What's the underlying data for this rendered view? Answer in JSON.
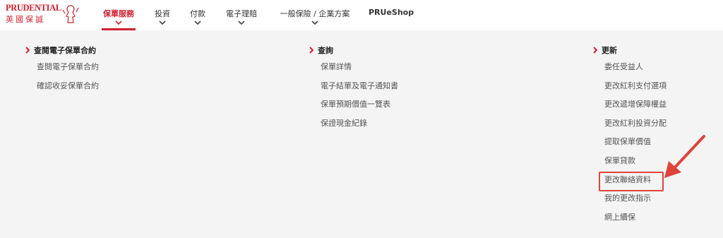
{
  "header": {
    "logo": {
      "brand": "PRUDENTIAL",
      "chinese": "英國保誠",
      "icon": "prudential-lady-logo-icon"
    },
    "nav": [
      {
        "label": "保單服務",
        "active": true,
        "chevron": true
      },
      {
        "label": "投資",
        "active": false,
        "chevron": true
      },
      {
        "label": "付款",
        "active": false,
        "chevron": true
      },
      {
        "label": "電子理賠",
        "active": false,
        "chevron": true
      },
      {
        "label": "一般保險 / 企業方案",
        "active": false,
        "chevron": true
      },
      {
        "label": "PRUeShop",
        "active": false,
        "chevron": false
      }
    ]
  },
  "menu": {
    "columns": [
      {
        "title": "查閱電子保單合約",
        "items": [
          "查閱電子保單合約",
          "確認收妥保單合約"
        ]
      },
      {
        "title": "查詢",
        "items": [
          "保單詳情",
          "電子結單及電子通知書",
          "保單預期價值一覽表",
          "保證現金紀錄"
        ]
      },
      {
        "title": "更新",
        "items": [
          "委任受益人",
          "更改紅利支付選項",
          "更改遞增保障權益",
          "更改紅利投資分配",
          "提取保單價值",
          "保單貸款",
          "更改聯絡資料",
          "我的更改指示",
          "網上續保"
        ]
      }
    ],
    "highlighted_item": "更改聯絡資料"
  },
  "colors": {
    "brand_red": "#d2202f",
    "panel_bg": "#f4f4f4",
    "annotation_red": "#e0433a"
  }
}
